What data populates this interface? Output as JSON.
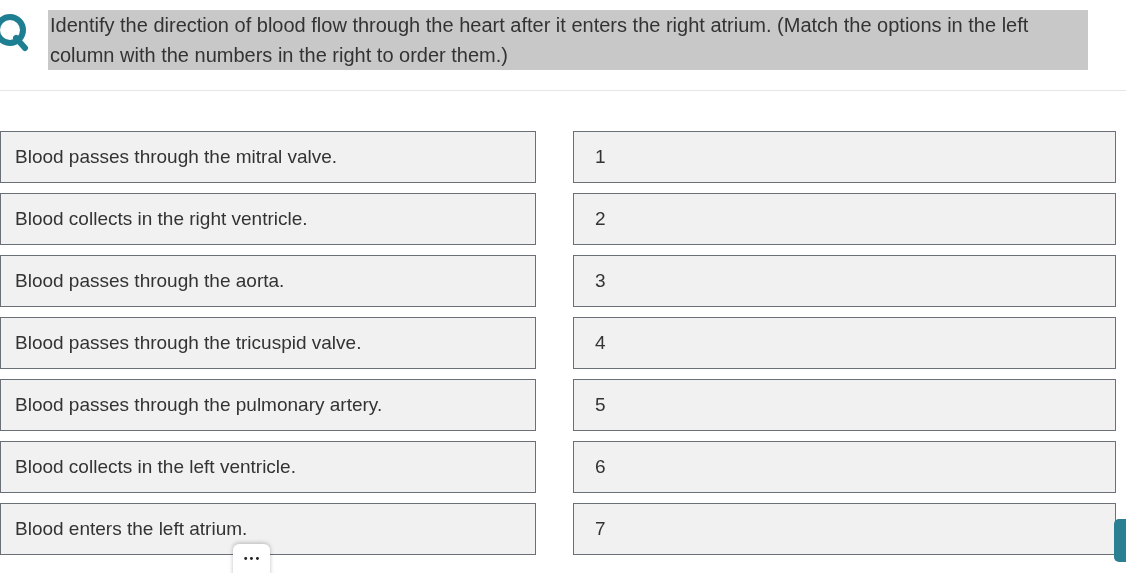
{
  "question": {
    "text": "Identify the direction of blood flow through the heart after it enters the right atrium. (Match the options in the left column with the numbers in the right to order them.)"
  },
  "options": [
    {
      "text": "Blood passes through the mitral valve."
    },
    {
      "text": "Blood collects in the right ventricle."
    },
    {
      "text": "Blood passes through the aorta."
    },
    {
      "text": "Blood passes through the tricuspid valve."
    },
    {
      "text": "Blood passes through the pulmonary artery."
    },
    {
      "text": "Blood collects in the left ventricle."
    },
    {
      "text": "Blood enters the left atrium."
    }
  ],
  "positions": [
    "1",
    "2",
    "3",
    "4",
    "5",
    "6",
    "7"
  ],
  "more_button": {
    "label": "•••"
  }
}
